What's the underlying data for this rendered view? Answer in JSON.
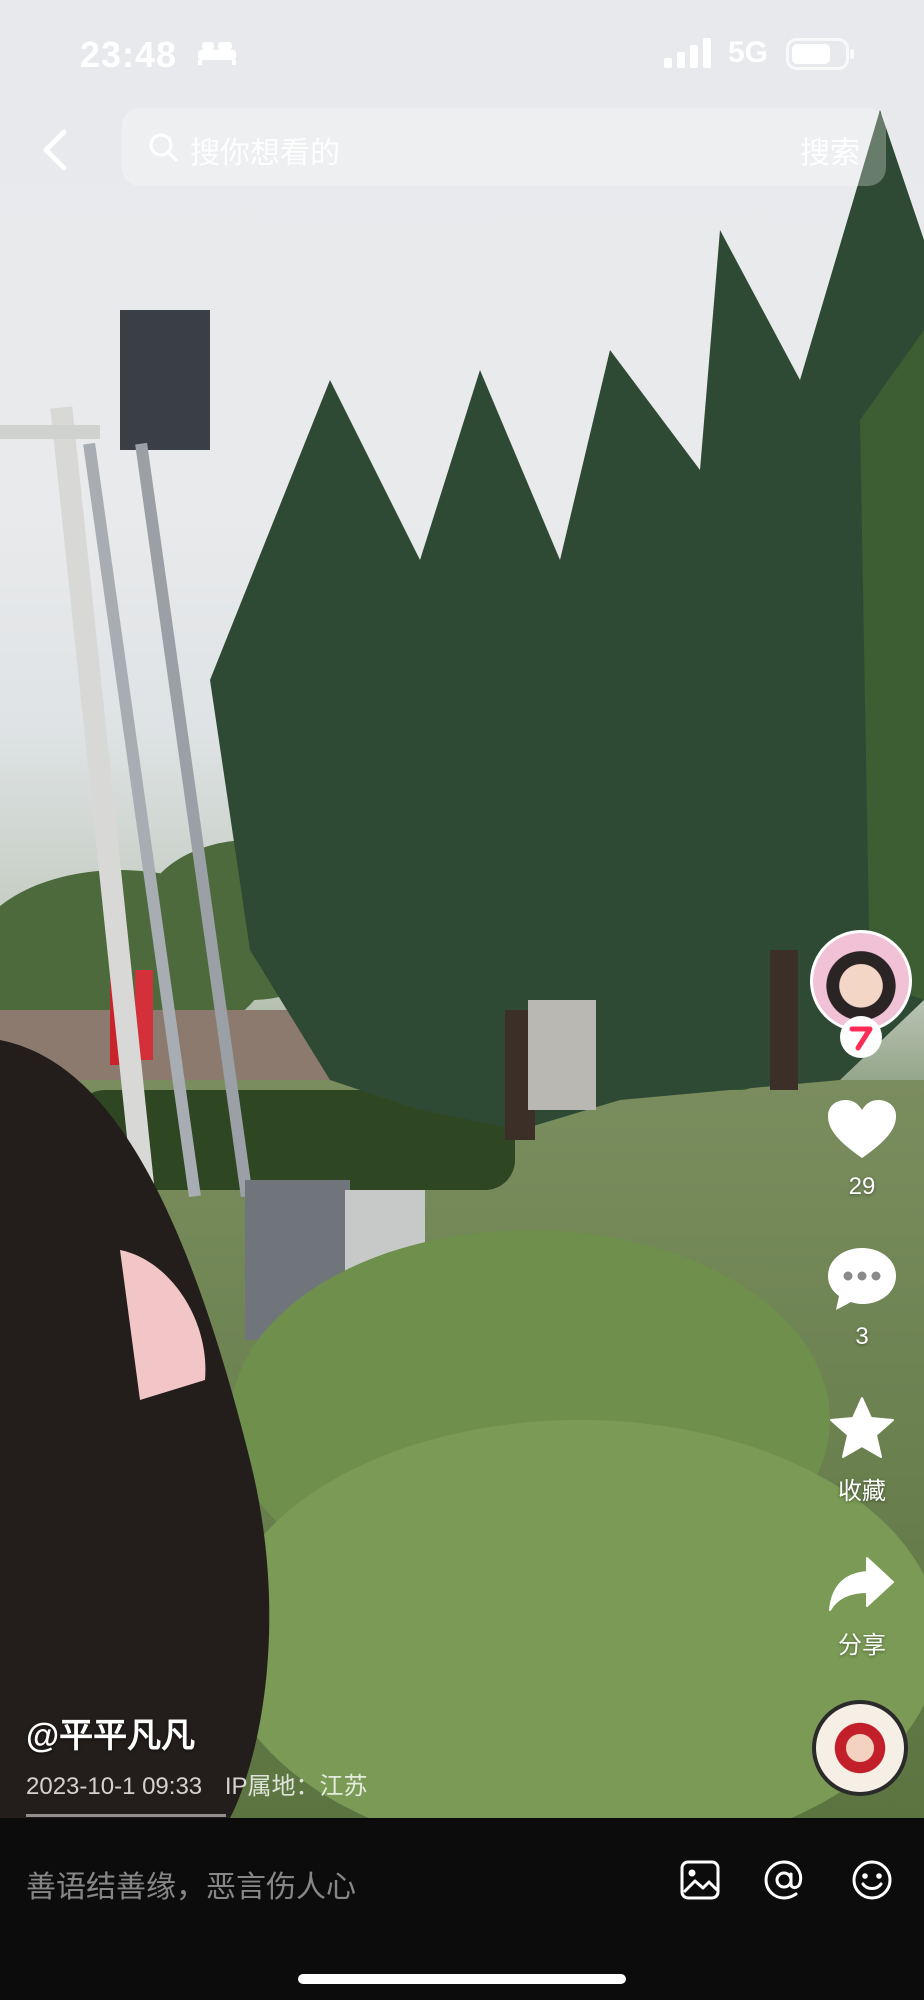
{
  "status_bar": {
    "time": "23:48",
    "network": "5G",
    "icons": [
      "bed-icon",
      "signal-icon",
      "battery-icon"
    ]
  },
  "header": {
    "back_icon": "chevron-left-icon",
    "search_placeholder": "搜你想看的",
    "search_button": "搜索"
  },
  "side_rail": {
    "like_count": "29",
    "comment_count": "3",
    "favorite_label": "收藏",
    "share_label": "分享"
  },
  "video_info": {
    "author": "@平平凡凡",
    "date": "2023-10-1 09:33",
    "ip_location": "IP属地：江苏"
  },
  "comment_bar": {
    "placeholder": "善语结善缘，恶言伤人心",
    "icons": [
      "image-icon",
      "at-icon",
      "emoji-icon"
    ]
  },
  "colors": {
    "sky": "#e7e9ec",
    "foliage": "#3f5a2f",
    "grass": "#6f8a5a",
    "like_white": "#ffffff",
    "follow_red": "#fe2c55",
    "bottom_bar": "#0c0c0c"
  }
}
